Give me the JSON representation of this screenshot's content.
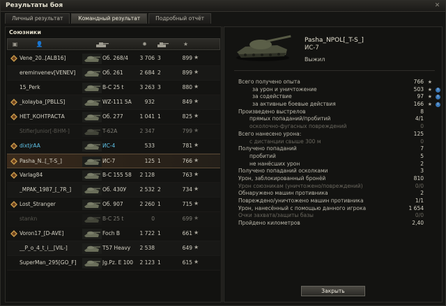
{
  "window": {
    "title": "Результаты боя"
  },
  "tabs": [
    {
      "label": "Личный результат",
      "active": false
    },
    {
      "label": "Командный результат",
      "active": true
    },
    {
      "label": "Подробный отчёт",
      "active": false
    }
  ],
  "team": {
    "header": "Союзники",
    "rows": [
      {
        "name": "Vene_20..[ALB16]",
        "vehicle": "Об. 268/4",
        "damage": "3 706",
        "kills": "3",
        "xp": "899",
        "status": "normal",
        "medal": true
      },
      {
        "name": "ereminvenev[VENEV]",
        "vehicle": "Об. 261",
        "damage": "2 684",
        "kills": "2",
        "xp": "899",
        "status": "normal",
        "medal": false
      },
      {
        "name": "15_Perk",
        "vehicle": "B-C 25 t",
        "damage": "3 263",
        "kills": "3",
        "xp": "880",
        "status": "normal",
        "medal": false
      },
      {
        "name": "_kolayba_[PBLLS]",
        "vehicle": "WZ-111 5A",
        "damage": "932",
        "kills": "",
        "xp": "849",
        "status": "normal",
        "medal": true
      },
      {
        "name": "НЕТ_КОНТРАСТА",
        "vehicle": "Об. 277",
        "damage": "1 041",
        "kills": "1",
        "xp": "825",
        "status": "normal",
        "medal": true
      },
      {
        "name": "StifierJunior[-BHM-]",
        "vehicle": "T-62A",
        "damage": "2 347",
        "kills": "",
        "xp": "799",
        "status": "dead",
        "medal": false
      },
      {
        "name": "dixtjrAA",
        "vehicle": "ИС-4",
        "damage": "533",
        "kills": "",
        "xp": "781",
        "status": "platoon",
        "medal": true
      },
      {
        "name": "Pasha_N..[_T-S_]",
        "vehicle": "ИС-7",
        "damage": "125",
        "kills": "1",
        "xp": "766",
        "status": "me",
        "medal": true
      },
      {
        "name": "Varlag84",
        "vehicle": "B-C 155 58",
        "damage": "2 128",
        "kills": "",
        "xp": "763",
        "status": "normal",
        "medal": true
      },
      {
        "name": "_MPAK_1987_[_7R_]",
        "vehicle": "Об. 430У",
        "damage": "2 532",
        "kills": "2",
        "xp": "734",
        "status": "normal",
        "medal": false
      },
      {
        "name": "Lost_Stranger",
        "vehicle": "Об. 907",
        "damage": "2 260",
        "kills": "1",
        "xp": "715",
        "status": "normal",
        "medal": true
      },
      {
        "name": "stankn",
        "vehicle": "B-C 25 t",
        "damage": "0",
        "kills": "",
        "xp": "699",
        "status": "dead",
        "medal": false
      },
      {
        "name": "Voron17_[D-AVE]",
        "vehicle": "Foch B",
        "damage": "1 722",
        "kills": "1",
        "xp": "661",
        "status": "normal",
        "medal": true
      },
      {
        "name": "__P_o_4_t_i__[VIL-]",
        "vehicle": "T57 Heavy",
        "damage": "2 538",
        "kills": "",
        "xp": "649",
        "status": "normal",
        "medal": false
      },
      {
        "name": "SuperMan_295[GO_F]",
        "vehicle": "Jg.Pz. E 100",
        "damage": "2 123",
        "kills": "1",
        "xp": "615",
        "status": "normal",
        "medal": false
      }
    ]
  },
  "player": {
    "name": "Pasha_NPOL[_T-S_]",
    "tank": "ИС-7",
    "status": "Выжил"
  },
  "stats": [
    {
      "label": "Всего получено опыта",
      "value": "766",
      "indent": 0,
      "star": true,
      "info": false,
      "dim": false
    },
    {
      "label": "за урон и уничтожение",
      "value": "503",
      "indent": 1,
      "star": true,
      "info": true,
      "dim": false
    },
    {
      "label": "за содействие",
      "value": "97",
      "indent": 1,
      "star": true,
      "info": true,
      "dim": false
    },
    {
      "label": "за активные боевые действия",
      "value": "166",
      "indent": 1,
      "star": true,
      "info": true,
      "dim": false
    },
    {
      "label": "Произведено выстрелов",
      "value": "8",
      "indent": 0,
      "star": false,
      "info": false,
      "dim": false
    },
    {
      "label": "прямых попаданий/пробитий",
      "value": "4/1",
      "indent": 2,
      "star": false,
      "info": false,
      "dim": false
    },
    {
      "label": "осколочно-фугасных повреждений",
      "value": "0",
      "indent": 2,
      "star": false,
      "info": false,
      "dim": true
    },
    {
      "label": "Всего нанесено урона:",
      "value": "125",
      "indent": 0,
      "star": false,
      "info": false,
      "dim": false
    },
    {
      "label": "с дистанции свыше 300 м",
      "value": "0",
      "indent": 2,
      "star": false,
      "info": false,
      "dim": true
    },
    {
      "label": "Получено попаданий",
      "value": "7",
      "indent": 0,
      "star": false,
      "info": false,
      "dim": false
    },
    {
      "label": "пробитий",
      "value": "5",
      "indent": 2,
      "star": false,
      "info": false,
      "dim": false
    },
    {
      "label": "не нанёсших урон",
      "value": "2",
      "indent": 2,
      "star": false,
      "info": false,
      "dim": false
    },
    {
      "label": "Получено попаданий осколками",
      "value": "3",
      "indent": 0,
      "star": false,
      "info": false,
      "dim": false
    },
    {
      "label": "Урон, заблокированный бронёй",
      "value": "810",
      "indent": 0,
      "star": false,
      "info": false,
      "dim": false
    },
    {
      "label": "Урон союзникам (уничтожено/повреждений)",
      "value": "0/0",
      "indent": 0,
      "star": false,
      "info": false,
      "dim": true
    },
    {
      "label": "Обнаружено машин противника",
      "value": "2",
      "indent": 0,
      "star": false,
      "info": false,
      "dim": false
    },
    {
      "label": "Повреждено/уничтожено машин противника",
      "value": "1/1",
      "indent": 0,
      "star": false,
      "info": false,
      "dim": false
    },
    {
      "label": "Урон, нанесённый с помощью данного игрока",
      "value": "1 654",
      "indent": 0,
      "star": false,
      "info": false,
      "dim": false
    },
    {
      "label": "Очки захвата/защиты базы",
      "value": "0/0",
      "indent": 0,
      "star": false,
      "info": false,
      "dim": true
    },
    {
      "label": "Пройдено километров",
      "value": "2,40",
      "indent": 0,
      "star": false,
      "info": false,
      "dim": false
    }
  ],
  "buttons": {
    "close": "Закрыть"
  },
  "icons": {
    "header": [
      "medal-column-icon",
      "player-column-icon",
      "vehicle-column-icon",
      "damage-column-icon",
      "kills-column-icon",
      "xp-column-icon"
    ]
  }
}
